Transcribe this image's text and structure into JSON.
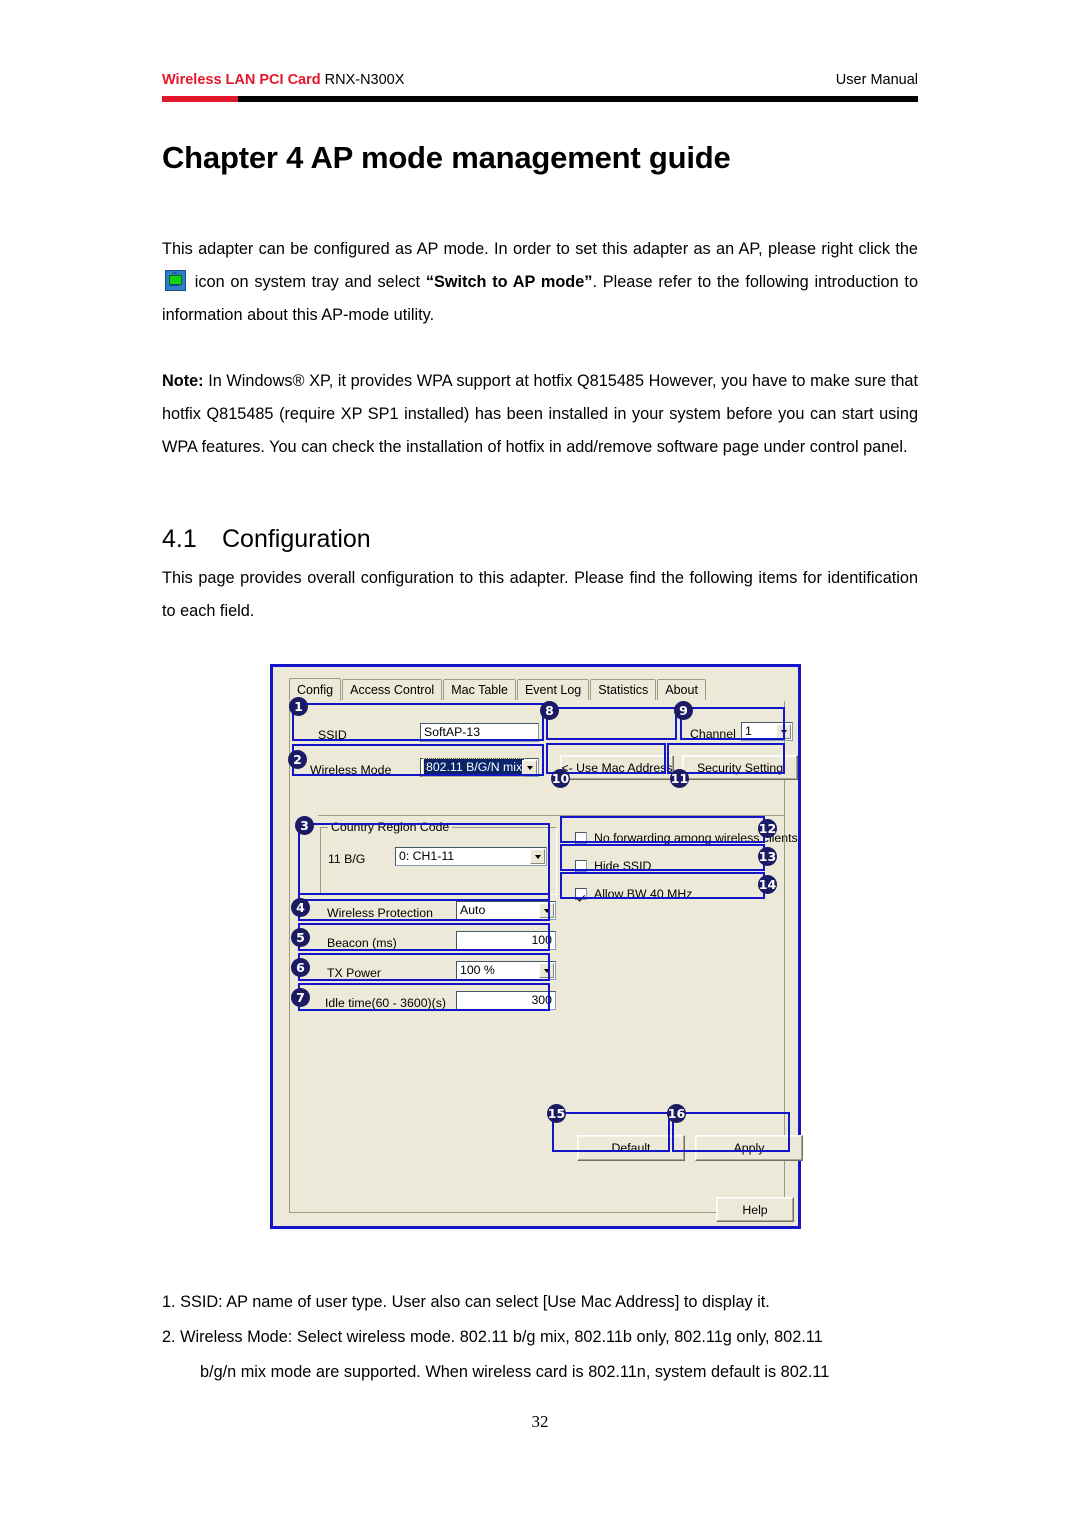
{
  "header": {
    "brand": "Wireless LAN PCI Card",
    "model": "RNX-N300X",
    "right": "User Manual"
  },
  "chapter_title": "Chapter 4 AP mode management guide",
  "paragraphs": {
    "intro_a": "This adapter can be configured as AP mode. In order to set this adapter as an AP, please right click the",
    "intro_b": "icon on system tray and select",
    "intro_bold": "“Switch to AP mode”",
    "intro_c": ". Please refer to the following introduction to information about this AP-mode utility.",
    "note_label": "Note:",
    "note_text": " In Windows® XP, it provides WPA support at hotfix Q815485 However, you have to make sure that hotfix Q815485 (require XP SP1 installed) has been installed in your system before you can start using WPA features. You can check the installation of hotfix in add/remove software page under control panel."
  },
  "section": {
    "number": "4.1",
    "title": "Configuration",
    "body": "This page provides overall configuration to this adapter. Please find the following items for identification to each field."
  },
  "dialog": {
    "tabs": [
      {
        "label": "Config",
        "active": true
      },
      {
        "label": "Access Control",
        "active": false
      },
      {
        "label": "Mac Table",
        "active": false
      },
      {
        "label": "Event Log",
        "active": false
      },
      {
        "label": "Statistics",
        "active": false
      },
      {
        "label": "About",
        "active": false
      }
    ],
    "ssid": {
      "label": "SSID",
      "value": "SoftAP-13"
    },
    "wireless_mode": {
      "label": "Wireless Mode",
      "value": "802.11 B/G/N mix"
    },
    "use_mac_address": "<- Use Mac Address",
    "channel": {
      "label": "Channel",
      "value": "1"
    },
    "security_setting": "Security Setting",
    "country_region": {
      "title": "Country Region Code",
      "band_label": "11 B/G",
      "value": "0: CH1-11"
    },
    "wireless_protection": {
      "label": "Wireless Protection",
      "value": "Auto"
    },
    "beacon": {
      "label": "Beacon (ms)",
      "value": "100"
    },
    "tx_power": {
      "label": "TX Power",
      "value": "100 %"
    },
    "idle_time": {
      "label": "Idle time(60 - 3600)(s)",
      "value": "300"
    },
    "checkboxes": [
      {
        "label": "No forwarding among wireless clients",
        "checked": false
      },
      {
        "label": "Hide SSID",
        "checked": false
      },
      {
        "label": "Allow BW 40 MHz",
        "checked": true
      }
    ],
    "buttons": {
      "default": "Default",
      "apply": "Apply",
      "help": "Help"
    },
    "badges": [
      "1",
      "2",
      "3",
      "4",
      "5",
      "6",
      "7",
      "8",
      "9",
      "10",
      "11",
      "12",
      "13",
      "14",
      "15",
      "16"
    ],
    "colors": {
      "callout": "#1414c8",
      "badge": "#1b1b63",
      "window_bg": "#ECE9D8",
      "selection": "#0a246a"
    }
  },
  "notes_list": [
    {
      "num": "1.",
      "text": "SSID: AP name of user type. User also can select [Use Mac Address] to display it."
    },
    {
      "num": "2.",
      "text": "Wireless Mode: Select wireless mode. 802.11 b/g mix, 802.11b only, 802.11g only, 802.11"
    },
    {
      "num": "",
      "text": "b/g/n mix mode are supported. When wireless card is 802.11n, system default is 802.11"
    }
  ],
  "page_number": "32"
}
